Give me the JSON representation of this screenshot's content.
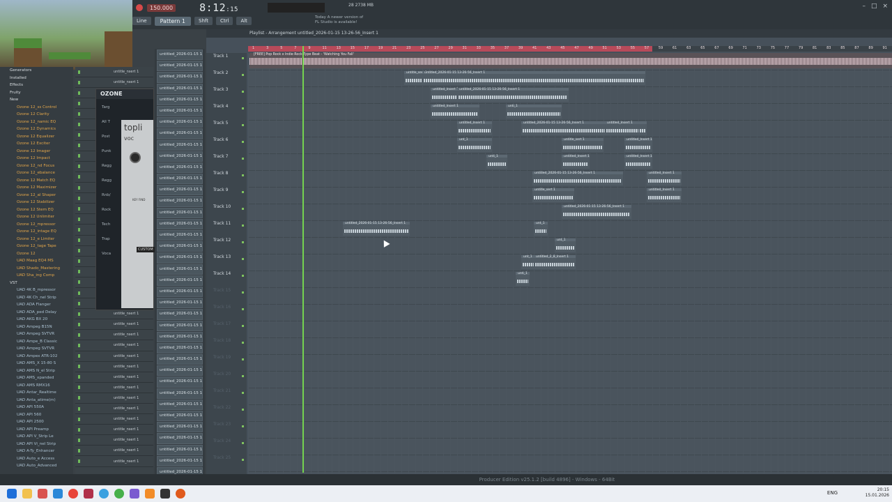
{
  "transport": {
    "tempo": "150.000",
    "time_main": "8:12",
    "time_sub": ":15",
    "pattern": "Pattern 1",
    "snap": "Line"
  },
  "news": {
    "line1": "Today  A newer version of",
    "line2": "FL Studio is available!"
  },
  "cpu": {
    "value": "28",
    "mem": "2738 MB"
  },
  "playlist": {
    "title": "Playlist - Arrangement  untitled_2026-01-15 13-26-56_Insert 1",
    "master_clip": "[FREE] Pop Rock x Indie Rock Type Beat - 'Watching You Fall'"
  },
  "browser_items": [
    {
      "t": "Generators",
      "k": "h"
    },
    {
      "t": "Installed",
      "k": "h"
    },
    {
      "t": "Effects",
      "k": "h"
    },
    {
      "t": "Fruity",
      "k": "h"
    },
    {
      "t": "New",
      "k": "h"
    },
    {
      "t": "Ozone 12_ss Control",
      "k": "f"
    },
    {
      "t": "Ozone 12 Clarity",
      "k": "f"
    },
    {
      "t": "Ozone 12_namic EQ",
      "k": "f"
    },
    {
      "t": "Ozone 12 Dynamics",
      "k": "f"
    },
    {
      "t": "Ozone 12 Equalizer",
      "k": "f"
    },
    {
      "t": "Ozone 12 Exciter",
      "k": "f"
    },
    {
      "t": "Ozone 12 Imager",
      "k": "f"
    },
    {
      "t": "Ozone 12 Impact",
      "k": "f"
    },
    {
      "t": "Ozone 12_nd Focus",
      "k": "f"
    },
    {
      "t": "Ozone 12_ebalance",
      "k": "f"
    },
    {
      "t": "Ozone 12 Match EQ",
      "k": "f"
    },
    {
      "t": "Ozone 12 Maximizer",
      "k": "f"
    },
    {
      "t": "Ozone 12_al Shaper",
      "k": "f"
    },
    {
      "t": "Ozone 12 Stabilizer",
      "k": "f"
    },
    {
      "t": "Ozone 12 Stem EQ",
      "k": "f"
    },
    {
      "t": "Ozone 12 Unlimiter",
      "k": "f"
    },
    {
      "t": "Ozone 12_mpressor",
      "k": "f"
    },
    {
      "t": "Ozone 12_intage EQ",
      "k": "f"
    },
    {
      "t": "Ozone 12_e Limiter",
      "k": "f"
    },
    {
      "t": "Ozone 12_tage Tape",
      "k": "f"
    },
    {
      "t": "Ozone 12",
      "k": "f"
    },
    {
      "t": "UAD Maag EQ4 MS",
      "k": "f"
    },
    {
      "t": "UAD Shado_Mastering",
      "k": "f"
    },
    {
      "t": "UAD Sha_ing Comp",
      "k": "f"
    },
    {
      "t": "VST",
      "k": "h"
    },
    {
      "t": "UAD 4K B_mpressor",
      "k": "v"
    },
    {
      "t": "UAD 4K Ch_nel Strip",
      "k": "v"
    },
    {
      "t": "UAD ADA Flanger",
      "k": "v"
    },
    {
      "t": "UAD ADA_ped Delay",
      "k": "v"
    },
    {
      "t": "UAD AKG BX 20",
      "k": "v"
    },
    {
      "t": "UAD Ampeg B15N",
      "k": "v"
    },
    {
      "t": "UAD Ampeg SVTVR",
      "k": "v"
    },
    {
      "t": "UAD Ampe_B Classic",
      "k": "v"
    },
    {
      "t": "UAD Ampeg SVTVR",
      "k": "v"
    },
    {
      "t": "UAD Ampex ATR-102",
      "k": "v"
    },
    {
      "t": "UAD AMS_X 15-80 S",
      "k": "v"
    },
    {
      "t": "UAD AMS N_el Strip",
      "k": "v"
    },
    {
      "t": "UAD AMS_xpanded",
      "k": "v"
    },
    {
      "t": "UAD AMS RMX16",
      "k": "v"
    },
    {
      "t": "UAD Antar_Realtime",
      "k": "v"
    },
    {
      "t": "UAD Anta_atime(m)",
      "k": "v"
    },
    {
      "t": "UAD API 550A",
      "k": "v"
    },
    {
      "t": "UAD API 560",
      "k": "v"
    },
    {
      "t": "UAD API 2500",
      "k": "v"
    },
    {
      "t": "UAD API Preamp",
      "k": "v"
    },
    {
      "t": "UAD API V_Strip Le",
      "k": "v"
    },
    {
      "t": "UAD API Vi_nel Strip",
      "k": "v"
    },
    {
      "t": "UAD A-Ty_Enhancer",
      "k": "v"
    },
    {
      "t": "UAD Auto_e Access",
      "k": "v"
    },
    {
      "t": "UAD Auto_Advanced",
      "k": "v"
    }
  ],
  "ozone": {
    "title": "OZONE",
    "side": [
      "Targ",
      "All T",
      "Post",
      "Punk",
      "Regg",
      "Regg",
      "Rnb/",
      "Rock",
      "Tech",
      "Trap",
      "Voca"
    ],
    "plugin": "topli",
    "plugin_sub": "voc",
    "key_find": "KEY FIND",
    "custom": "CUSTOM"
  },
  "mixer_label": "untitle_nsert 1",
  "channel_label": "untitled_2026-01-15 13-",
  "tracks": [
    "Track 1",
    "Track 2",
    "Track 3",
    "Track 4",
    "Track 5",
    "Track 6",
    "Track 7",
    "Track 8",
    "Track 9",
    "Track 10",
    "Track 11",
    "Track 12",
    "Track 13",
    "Track 14",
    "Track 15",
    "Track 16",
    "Track 17",
    "Track 18",
    "Track 19",
    "Track 20",
    "Track 21",
    "Track 22",
    "Track 23",
    "Track 24",
    "Track 25"
  ],
  "ruler_numbers": [
    "1",
    "3",
    "5",
    "7",
    "9",
    "11",
    "13",
    "15",
    "17",
    "19",
    "21",
    "23",
    "25",
    "27",
    "29",
    "31",
    "33",
    "35",
    "37",
    "39",
    "41",
    "43",
    "45",
    "47",
    "49",
    "51",
    "53",
    "55",
    "57",
    "59",
    "61",
    "63",
    "65",
    "67",
    "69",
    "71",
    "73",
    "75",
    "77",
    "79",
    "81",
    "83",
    "85",
    "87",
    "89",
    "91"
  ],
  "clip_labels": {
    "a": "untitle_sert 1",
    "b": "untitled_2026-01-15 13-26-56_Insert 1",
    "c": "untitled_Insert 1",
    "d": "untitled_2026-01-15 13-26-56_Insert 1",
    "e": "untitled_2026-01-15 13-26-56_Insert 1",
    "f": "untitled_2026-01-15 13-26-56_Insert 1",
    "g": "untitled_2026-01-15 13-26-56_Insert 1",
    "h": "untitled_2_8_Insert 1",
    "i": "untitle_sert 1",
    "j": "unti_1",
    "k": "unt_1"
  },
  "status": "Producer Edition v25.1.2 [build 4896] - Windows - 64Bit",
  "tray": {
    "lang": "ENG",
    "time": "20:15",
    "date": "15.01.2026"
  },
  "colors": {
    "accent": "#b84a5a",
    "playhead": "#74d34f",
    "folder": "#e1a54a"
  }
}
